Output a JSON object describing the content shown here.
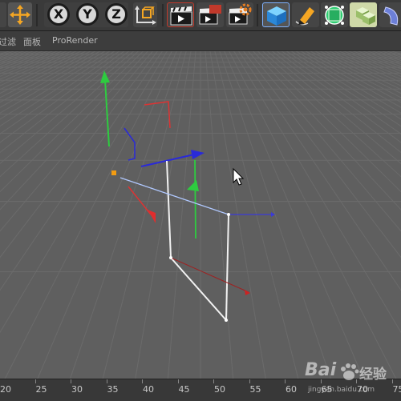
{
  "toolbar": {
    "buttons": [
      {
        "name": "move-tool-button",
        "icon": "move-arrows-icon"
      },
      {
        "name": "x-axis-button",
        "label": "X"
      },
      {
        "name": "y-axis-button",
        "label": "Y"
      },
      {
        "name": "z-axis-button",
        "label": "Z"
      },
      {
        "name": "coordinate-system-button",
        "icon": "world-coords-icon"
      },
      {
        "name": "render-view-button",
        "icon": "clapboard-icon"
      },
      {
        "name": "render-picture-viewer-button",
        "icon": "clapboard-red-icon"
      },
      {
        "name": "render-settings-button",
        "icon": "clapboard-gear-icon"
      },
      {
        "name": "cube-primitive-button",
        "icon": "cube-icon"
      },
      {
        "name": "pen-spline-button",
        "icon": "pen-icon"
      },
      {
        "name": "subdivision-button",
        "icon": "green-cube-icon"
      },
      {
        "name": "array-button",
        "icon": "cubes-icon"
      },
      {
        "name": "deformer-button",
        "icon": "bend-icon"
      }
    ]
  },
  "menubar": {
    "items": [
      "过滤",
      "面板",
      "ProRender"
    ]
  },
  "timeline": {
    "ticks": [
      "20",
      "25",
      "30",
      "35",
      "40",
      "45",
      "50",
      "55",
      "60",
      "65",
      "70",
      "75"
    ]
  },
  "watermark": {
    "logo": "Bai",
    "suffix": "经验",
    "url": "jingyan.baidu.com"
  },
  "colors": {
    "x_axis": "#e03a3a",
    "y_axis": "#30c030",
    "z_axis": "#3a3ae0",
    "viewport_bg": "#5f5f5f",
    "grid": "#6b6b6b",
    "selection_outline": "#e0e0e0",
    "highlight_orange": "#f39c12"
  }
}
